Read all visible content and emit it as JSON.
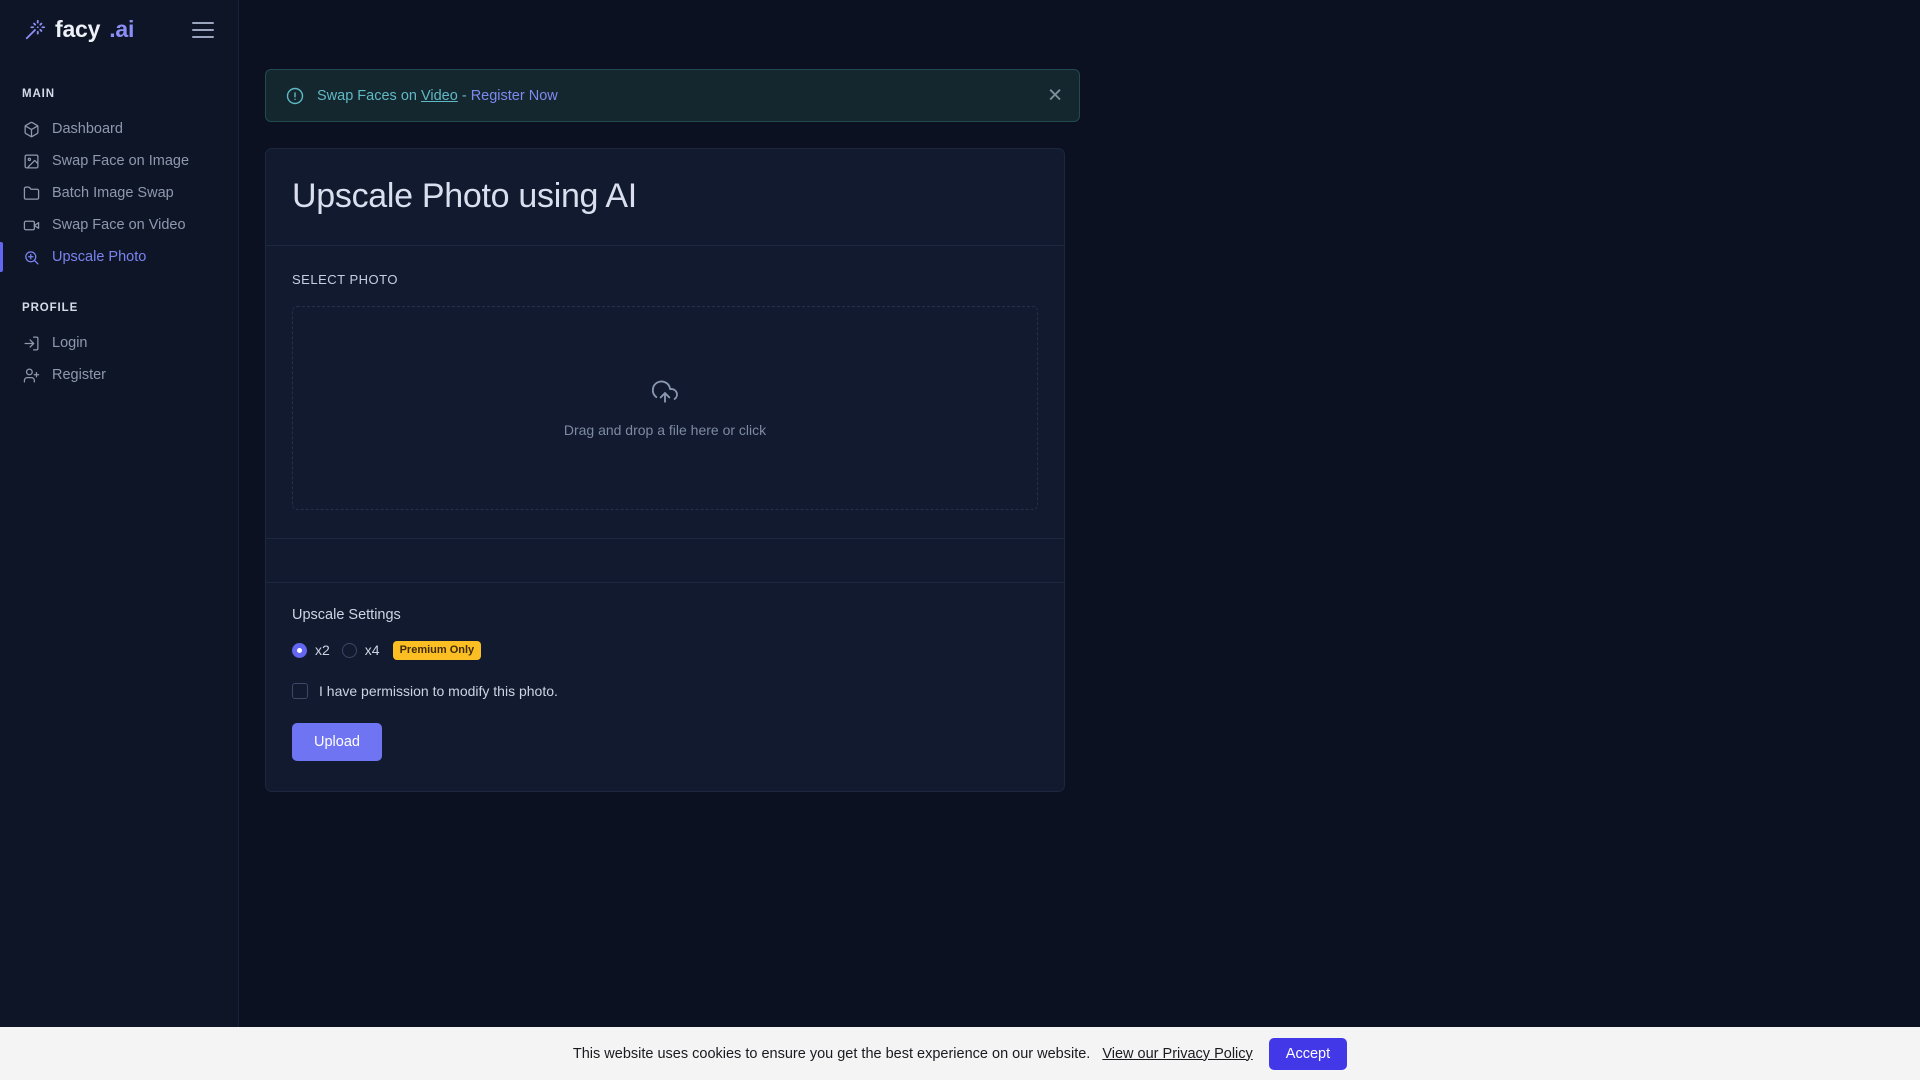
{
  "brand": {
    "name": "facy",
    "suffix": ".ai",
    "icon": "magic-wand-icon"
  },
  "sidebar": {
    "menu_toggle_icon": "hamburger-menu-icon",
    "sections": [
      {
        "label": "MAIN",
        "items": [
          {
            "label": "Dashboard",
            "icon": "cube-icon",
            "active": false
          },
          {
            "label": "Swap Face on Image",
            "icon": "image-icon",
            "active": false
          },
          {
            "label": "Batch Image Swap",
            "icon": "folder-icon",
            "active": false
          },
          {
            "label": "Swap Face on Video",
            "icon": "video-icon",
            "active": false
          },
          {
            "label": "Upscale Photo",
            "icon": "zoom-in-icon",
            "active": true
          }
        ]
      },
      {
        "label": "PROFILE",
        "items": [
          {
            "label": "Login",
            "icon": "login-icon",
            "active": false
          },
          {
            "label": "Register",
            "icon": "user-plus-icon",
            "active": false
          }
        ]
      }
    ]
  },
  "alert": {
    "icon": "alert-circle-icon",
    "text_lead": "Swap Faces on ",
    "link_text": "Video",
    "separator": " - ",
    "cta_text": "Register Now",
    "close_icon": "close-icon",
    "color": "#5fb9c4",
    "cta_color": "#7d8af0"
  },
  "card": {
    "title": "Upscale Photo using AI",
    "select_photo_label": "SELECT PHOTO",
    "dropzone": {
      "icon": "cloud-upload-icon",
      "text": "Drag and drop a file here or click"
    },
    "settings": {
      "title": "Upscale Settings",
      "options": [
        {
          "label": "x2",
          "selected": true,
          "badge": null
        },
        {
          "label": "x4",
          "selected": false,
          "badge": "Premium Only"
        }
      ],
      "badge_color": "#fbbf24",
      "permission_label": "I have permission to modify this photo.",
      "permission_checked": false,
      "upload_label": "Upload",
      "upload_color": "#6f74f2"
    }
  },
  "cookie_bar": {
    "text": "This website uses cookies to ensure you get the best experience on our website.",
    "link_label": "View our Privacy Policy",
    "accept_label": "Accept",
    "accept_color": "#4338e8"
  }
}
